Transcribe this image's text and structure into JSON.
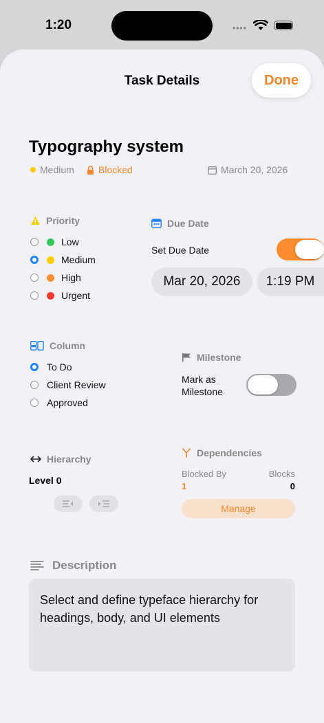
{
  "status_bar": {
    "time": "1:20",
    "signal_dots": "••••"
  },
  "header": {
    "title": "Task Details",
    "done_label": "Done"
  },
  "task": {
    "title": "Typography system",
    "priority_label": "Medium",
    "status_label": "Blocked",
    "date_label": "March 20, 2026"
  },
  "priority": {
    "title": "Priority",
    "options": [
      {
        "label": "Low",
        "color": "#34c759",
        "selected": false
      },
      {
        "label": "Medium",
        "color": "#ffcc00",
        "selected": true
      },
      {
        "label": "High",
        "color": "#ff8c2e",
        "selected": false
      },
      {
        "label": "Urgent",
        "color": "#ff3b30",
        "selected": false
      }
    ]
  },
  "due_date": {
    "title": "Due Date",
    "toggle_label": "Set Due Date",
    "toggle_on": true,
    "date_value": "Mar 20, 2026",
    "time_value": "1:19 PM"
  },
  "column": {
    "title": "Column",
    "options": [
      {
        "label": "To Do",
        "selected": true
      },
      {
        "label": "Client Review",
        "selected": false
      },
      {
        "label": "Approved",
        "selected": false
      }
    ]
  },
  "milestone": {
    "title": "Milestone",
    "toggle_label_line1": "Mark as",
    "toggle_label_line2": "Milestone",
    "toggle_on": false
  },
  "hierarchy": {
    "title": "Hierarchy",
    "level_label": "Level 0"
  },
  "dependencies": {
    "title": "Dependencies",
    "blocked_by_label": "Blocked By",
    "blocked_by_value": "1",
    "blocks_label": "Blocks",
    "blocks_value": "0",
    "manage_label": "Manage"
  },
  "description": {
    "title": "Description",
    "text": "Select and define typeface hierarchy for headings, body, and UI elements"
  },
  "colors": {
    "accent": "#f5862a",
    "blue": "#1e84ff",
    "muted": "#888888"
  }
}
